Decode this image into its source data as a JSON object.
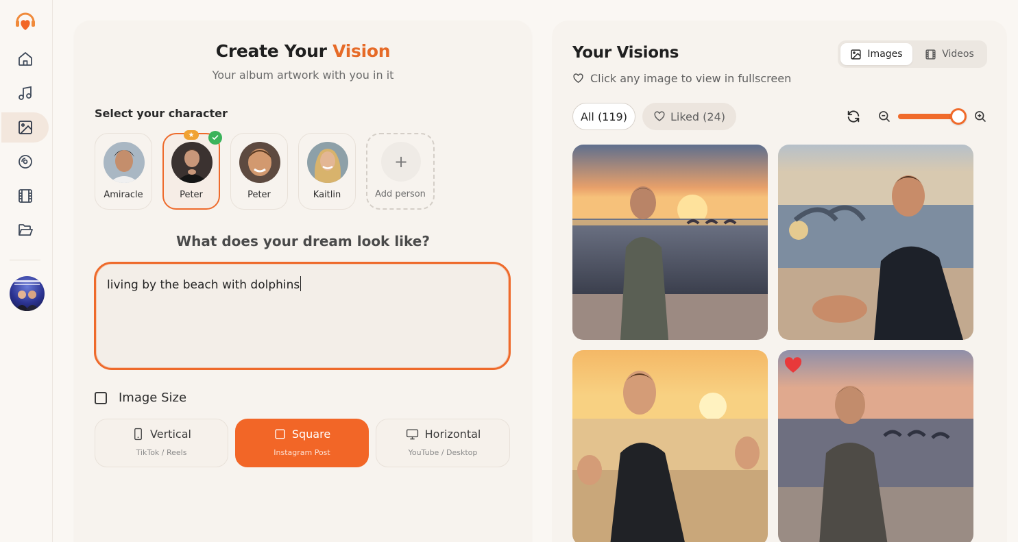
{
  "sidebar": {
    "logo": "heart-headphones-logo",
    "items": [
      {
        "name": "home",
        "icon": "home-icon",
        "active": false
      },
      {
        "name": "music",
        "icon": "music-note-icon",
        "active": false
      },
      {
        "name": "images",
        "icon": "image-icon",
        "active": true
      },
      {
        "name": "albums",
        "icon": "vinyl-disc-icon",
        "active": false
      },
      {
        "name": "videos",
        "icon": "film-icon",
        "active": false
      },
      {
        "name": "projects",
        "icon": "folder-open-icon",
        "active": false
      }
    ],
    "avatar": "user-avatar"
  },
  "create": {
    "title_prefix": "Create Your",
    "title_accent": "Vision",
    "subtitle": "Your album artwork with you in it",
    "character_label": "Select your character",
    "characters": [
      {
        "name": "Amiracle",
        "selected": false
      },
      {
        "name": "Peter",
        "selected": true,
        "starred": true
      },
      {
        "name": "Peter",
        "selected": false
      },
      {
        "name": "Kaitlin",
        "selected": false
      }
    ],
    "add_person_label": "Add person",
    "dream_label": "What does your dream look like?",
    "dream_text": "living by the beach with dolphins",
    "image_size_label": "Image Size",
    "sizes": [
      {
        "label": "Vertical",
        "sub": "TikTok / Reels",
        "icon": "phone-icon",
        "active": false
      },
      {
        "label": "Square",
        "sub": "Instagram Post",
        "icon": "square-icon",
        "active": true
      },
      {
        "label": "Horizontal",
        "sub": "YouTube / Desktop",
        "icon": "monitor-icon",
        "active": false
      }
    ]
  },
  "visions": {
    "title": "Your Visions",
    "hint": "Click any image to view in fullscreen",
    "tabs": [
      {
        "label": "Images",
        "active": true
      },
      {
        "label": "Videos",
        "active": false
      }
    ],
    "filters": [
      {
        "label": "All (119)",
        "active": true
      },
      {
        "label": "Liked (24)",
        "active": false
      }
    ],
    "zoom_level": 0.92,
    "images": [
      {
        "alt": "man smiling on beach at sunset with dolphins",
        "liked": false
      },
      {
        "alt": "man sitting on beach laughing with dolphins jumping",
        "liked": false
      },
      {
        "alt": "man with raised hands laughing on beach at sunset",
        "liked": false
      },
      {
        "alt": "man laughing in shallow water with dolphins",
        "liked": true
      }
    ]
  },
  "colors": {
    "accent": "#f26627",
    "background": "#faf7f3",
    "panel": "#f7f3ee",
    "success": "#3bb35b",
    "star": "#f0a233",
    "heart": "#e8393a"
  }
}
